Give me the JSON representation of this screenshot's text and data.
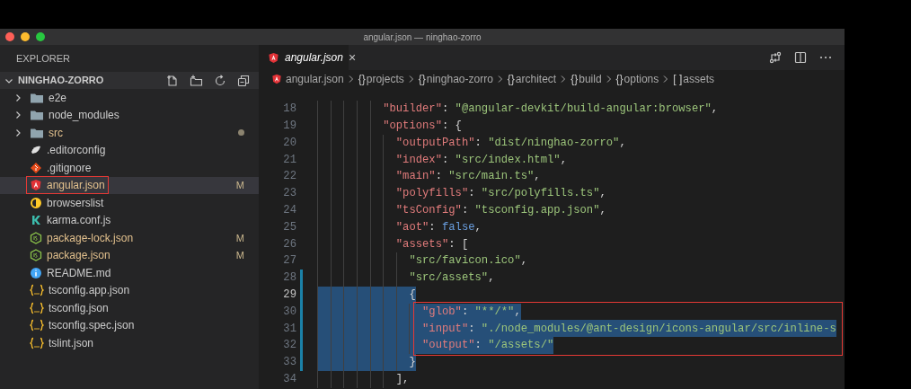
{
  "window": {
    "title": "angular.json — ninghao-zorro"
  },
  "sidebar": {
    "title": "EXPLORER",
    "project": {
      "name": "NINGHAO-ZORRO",
      "expanded": true
    },
    "items": [
      {
        "kind": "folder",
        "name": "e2e",
        "expanded": false,
        "modified": false,
        "has_changes": false,
        "selected": false,
        "annotated": false
      },
      {
        "kind": "folder",
        "name": "node_modules",
        "expanded": false,
        "modified": false,
        "has_changes": false,
        "selected": false,
        "annotated": false
      },
      {
        "kind": "folder",
        "name": "src",
        "expanded": false,
        "modified": true,
        "has_changes": true,
        "selected": false,
        "annotated": false
      },
      {
        "kind": "editorconfig",
        "name": ".editorconfig",
        "modified": false,
        "selected": false,
        "annotated": false
      },
      {
        "kind": "git",
        "name": ".gitignore",
        "modified": false,
        "selected": false,
        "annotated": false
      },
      {
        "kind": "angular",
        "name": "angular.json",
        "modified": true,
        "badge": "M",
        "selected": true,
        "annotated": true
      },
      {
        "kind": "browserslist",
        "name": "browserslist",
        "modified": false,
        "selected": false,
        "annotated": false
      },
      {
        "kind": "karma",
        "name": "karma.conf.js",
        "modified": false,
        "selected": false,
        "annotated": false
      },
      {
        "kind": "npm",
        "name": "package-lock.json",
        "modified": true,
        "badge": "M",
        "selected": false,
        "annotated": false
      },
      {
        "kind": "npm",
        "name": "package.json",
        "modified": true,
        "badge": "M",
        "selected": false,
        "annotated": false
      },
      {
        "kind": "info",
        "name": "README.md",
        "modified": false,
        "selected": false,
        "annotated": false
      },
      {
        "kind": "json",
        "name": "tsconfig.app.json",
        "modified": false,
        "selected": false,
        "annotated": false
      },
      {
        "kind": "json",
        "name": "tsconfig.json",
        "modified": false,
        "selected": false,
        "annotated": false
      },
      {
        "kind": "json",
        "name": "tsconfig.spec.json",
        "modified": false,
        "selected": false,
        "annotated": false
      },
      {
        "kind": "json",
        "name": "tslint.json",
        "modified": false,
        "selected": false,
        "annotated": false
      }
    ]
  },
  "editor": {
    "tabs": [
      {
        "label": "angular.json",
        "close": "×",
        "selected": true
      }
    ],
    "breadcrumb": {
      "file": "angular.json",
      "segments": [
        {
          "symbol": "{}",
          "label": "projects"
        },
        {
          "symbol": "{}",
          "label": "ninghao-zorro"
        },
        {
          "symbol": "{}",
          "label": "architect"
        },
        {
          "symbol": "{}",
          "label": "build"
        },
        {
          "symbol": "{}",
          "label": "options"
        },
        {
          "symbol": "[ ]",
          "label": "assets"
        }
      ]
    },
    "lines": [
      {
        "number": "18",
        "selected": false,
        "annotated": false,
        "changed": false,
        "current": false,
        "tokens": [
          {
            "kind": "key",
            "text": "          \"builder\""
          },
          {
            "kind": "punc",
            "text": ": "
          },
          {
            "kind": "str",
            "text": "\"@angular-devkit/build-angular:browser\""
          },
          {
            "kind": "punc",
            "text": ","
          }
        ]
      },
      {
        "number": "19",
        "selected": false,
        "annotated": false,
        "changed": false,
        "current": false,
        "tokens": [
          {
            "kind": "key",
            "text": "          \"options\""
          },
          {
            "kind": "punc",
            "text": ": {"
          }
        ]
      },
      {
        "number": "20",
        "selected": false,
        "annotated": false,
        "changed": false,
        "current": false,
        "tokens": [
          {
            "kind": "key",
            "text": "            \"outputPath\""
          },
          {
            "kind": "punc",
            "text": ": "
          },
          {
            "kind": "str",
            "text": "\"dist/ninghao-zorro\""
          },
          {
            "kind": "punc",
            "text": ","
          }
        ]
      },
      {
        "number": "21",
        "selected": false,
        "annotated": false,
        "changed": false,
        "current": false,
        "tokens": [
          {
            "kind": "key",
            "text": "            \"index\""
          },
          {
            "kind": "punc",
            "text": ": "
          },
          {
            "kind": "str",
            "text": "\"src/index.html\""
          },
          {
            "kind": "punc",
            "text": ","
          }
        ]
      },
      {
        "number": "22",
        "selected": false,
        "annotated": false,
        "changed": false,
        "current": false,
        "tokens": [
          {
            "kind": "key",
            "text": "            \"main\""
          },
          {
            "kind": "punc",
            "text": ": "
          },
          {
            "kind": "str",
            "text": "\"src/main.ts\""
          },
          {
            "kind": "punc",
            "text": ","
          }
        ]
      },
      {
        "number": "23",
        "selected": false,
        "annotated": false,
        "changed": false,
        "current": false,
        "tokens": [
          {
            "kind": "key",
            "text": "            \"polyfills\""
          },
          {
            "kind": "punc",
            "text": ": "
          },
          {
            "kind": "str",
            "text": "\"src/polyfills.ts\""
          },
          {
            "kind": "punc",
            "text": ","
          }
        ]
      },
      {
        "number": "24",
        "selected": false,
        "annotated": false,
        "changed": false,
        "current": false,
        "tokens": [
          {
            "kind": "key",
            "text": "            \"tsConfig\""
          },
          {
            "kind": "punc",
            "text": ": "
          },
          {
            "kind": "str",
            "text": "\"tsconfig.app.json\""
          },
          {
            "kind": "punc",
            "text": ","
          }
        ]
      },
      {
        "number": "25",
        "selected": false,
        "annotated": false,
        "changed": false,
        "current": false,
        "tokens": [
          {
            "kind": "key",
            "text": "            \"aot\""
          },
          {
            "kind": "punc",
            "text": ": "
          },
          {
            "kind": "bool",
            "text": "false"
          },
          {
            "kind": "punc",
            "text": ","
          }
        ]
      },
      {
        "number": "26",
        "selected": false,
        "annotated": false,
        "changed": false,
        "current": false,
        "tokens": [
          {
            "kind": "key",
            "text": "            \"assets\""
          },
          {
            "kind": "punc",
            "text": ": ["
          }
        ]
      },
      {
        "number": "27",
        "selected": false,
        "annotated": false,
        "changed": false,
        "current": false,
        "tokens": [
          {
            "kind": "str",
            "text": "              \"src/favicon.ico\""
          },
          {
            "kind": "punc",
            "text": ","
          }
        ]
      },
      {
        "number": "28",
        "selected": false,
        "annotated": false,
        "changed": true,
        "current": false,
        "tokens": [
          {
            "kind": "str",
            "text": "              \"src/assets\""
          },
          {
            "kind": "punc",
            "text": ","
          }
        ]
      },
      {
        "number": "29",
        "selected": true,
        "annotated": false,
        "changed": true,
        "current": true,
        "tokens": [
          {
            "kind": "punc",
            "text": "              {"
          }
        ]
      },
      {
        "number": "30",
        "selected": true,
        "annotated": true,
        "changed": true,
        "current": false,
        "tokens": [
          {
            "kind": "key",
            "text": "                \"glob\""
          },
          {
            "kind": "punc",
            "text": ": "
          },
          {
            "kind": "str",
            "text": "\"**/*\""
          },
          {
            "kind": "punc",
            "text": ","
          }
        ]
      },
      {
        "number": "31",
        "selected": true,
        "annotated": true,
        "changed": true,
        "current": false,
        "tokens": [
          {
            "kind": "key",
            "text": "                \"input\""
          },
          {
            "kind": "punc",
            "text": ": "
          },
          {
            "kind": "str",
            "text": "\"./node_modules/@ant-design/icons-angular/src/inline-s"
          }
        ]
      },
      {
        "number": "32",
        "selected": true,
        "annotated": true,
        "changed": true,
        "current": false,
        "tokens": [
          {
            "kind": "key",
            "text": "                \"output\""
          },
          {
            "kind": "punc",
            "text": ": "
          },
          {
            "kind": "str",
            "text": "\"/assets/\""
          }
        ]
      },
      {
        "number": "33",
        "selected": true,
        "annotated": false,
        "changed": true,
        "current": false,
        "tokens": [
          {
            "kind": "punc",
            "text": "              }"
          }
        ]
      },
      {
        "number": "34",
        "selected": false,
        "annotated": false,
        "changed": false,
        "current": false,
        "tokens": [
          {
            "kind": "punc",
            "text": "            ],"
          }
        ]
      }
    ]
  }
}
